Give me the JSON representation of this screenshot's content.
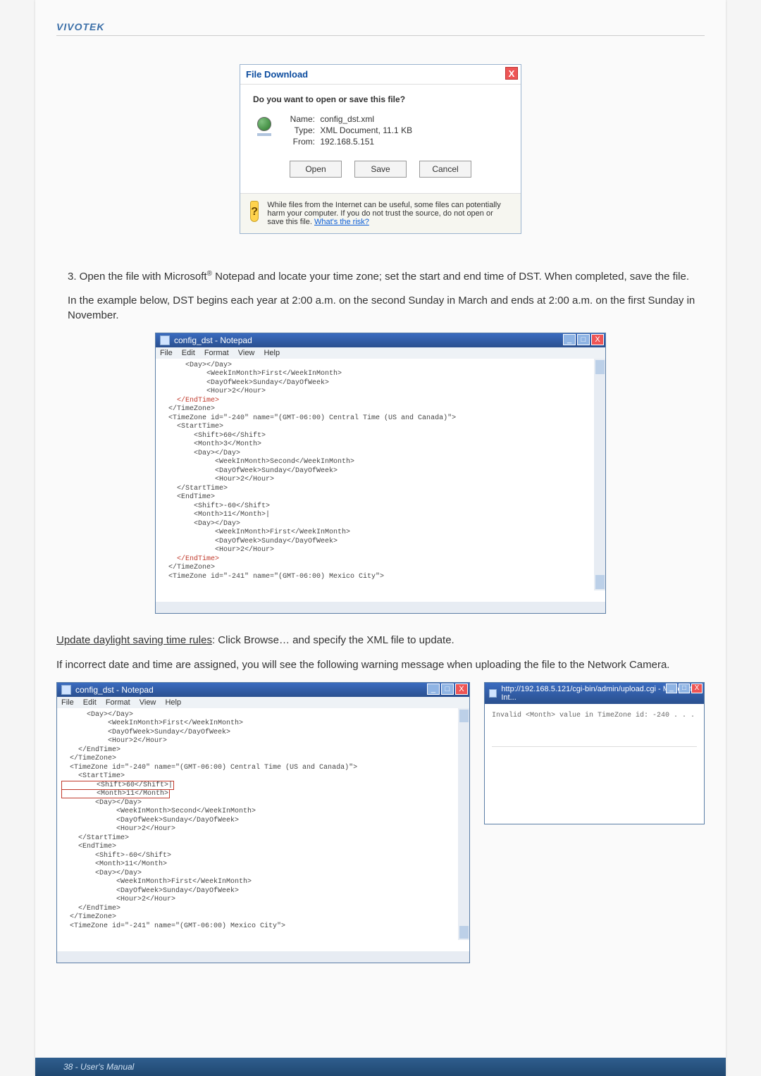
{
  "brand": "VIVOTEK",
  "fileDownload": {
    "title": "File Download",
    "prompt": "Do you want to open or save this file?",
    "labels": {
      "name": "Name:",
      "type": "Type:",
      "from": "From:"
    },
    "name": "config_dst.xml",
    "type": "XML Document, 11.1 KB",
    "from": "192.168.5.151",
    "buttons": {
      "open": "Open",
      "save": "Save",
      "cancel": "Cancel"
    },
    "warning": "While files from the Internet can be useful, some files can potentially harm your computer. If you do not trust the source, do not open or save this file. ",
    "riskLink": "What's the risk?"
  },
  "step3": {
    "prefix": "3. Open the file with Microsoft",
    "reg": "®",
    "rest": " Notepad and locate your time zone; set the start and end time of DST. When completed, save the file."
  },
  "example": "In the example below, DST begins each year at 2:00 a.m. on the second Sunday in March and ends at 2:00 a.m. on the first Sunday in November.",
  "notepadTitle": "config_dst - Notepad",
  "notepadMenu": {
    "file": "File",
    "edit": "Edit",
    "format": "Format",
    "view": "View",
    "help": "Help"
  },
  "notepad1_pre": "      <Day></Day>\n           <WeekInMonth>First</WeekInMonth>\n           <DayOfWeek>Sunday</DayOfWeek>\n           <Hour>2</Hour>\n",
  "notepad1_end1": "    </EndTime>",
  "notepad1_mid": "  </TimeZone>\n  <TimeZone id=\"-240\" name=\"(GMT-06:00) Central Time (US and Canada)\">\n    <StartTime>\n        <Shift>60</Shift>\n        <Month>3</Month>\n        <Day></Day>\n             <WeekInMonth>Second</WeekInMonth>\n             <DayOfWeek>Sunday</DayOfWeek>\n             <Hour>2</Hour>\n    </StartTime>\n    <EndTime>\n        <Shift>-60</Shift>\n        <Month>11</Month>|\n        <Day></Day>\n             <WeekInMonth>First</WeekInMonth>\n             <DayOfWeek>Sunday</DayOfWeek>\n             <Hour>2</Hour>\n",
  "notepad1_end2": "    </EndTime>",
  "notepad1_tail": "  </TimeZone>\n  <TimeZone id=\"-241\" name=\"(GMT-06:00) Mexico City\">",
  "updateLine_u": "Update daylight saving time rules",
  "updateLine_rest": ": Click Browse… and specify the XML file to update.",
  "incorrectLine": "If incorrect date and time are assigned, you will see the following warning message when uploading the file to the Network Camera.",
  "notepad2_a": "      <Day></Day>\n           <WeekInMonth>First</WeekInMonth>\n           <DayOfWeek>Sunday</DayOfWeek>\n           <Hour>2</Hour>\n    </EndTime>\n  </TimeZone>\n  <TimeZone id=\"-240\" name=\"(GMT-06:00) Central Time (US and Canada)\">\n    <StartTime>",
  "notepad2_bad1": "        <Shift>60</Shift>|",
  "notepad2_bad2": "        <Month>11</Month>",
  "notepad2_b": "        <Day></Day>\n             <WeekInMonth>Second</WeekInMonth>\n             <DayOfWeek>Sunday</DayOfWeek>\n             <Hour>2</Hour>\n    </StartTime>\n    <EndTime>\n        <Shift>-60</Shift>\n        <Month>11</Month>\n        <Day></Day>\n             <WeekInMonth>First</WeekInMonth>\n             <DayOfWeek>Sunday</DayOfWeek>\n             <Hour>2</Hour>\n    </EndTime>\n  </TimeZone>\n  <TimeZone id=\"-241\" name=\"(GMT-06:00) Mexico City\">",
  "ieTitle": "http://192.168.5.121/cgi-bin/admin/upload.cgi - Microsoft Int...",
  "ieMessage": "Invalid <Month> value in TimeZone id: -240 . . .",
  "footer": "38 - User's Manual"
}
